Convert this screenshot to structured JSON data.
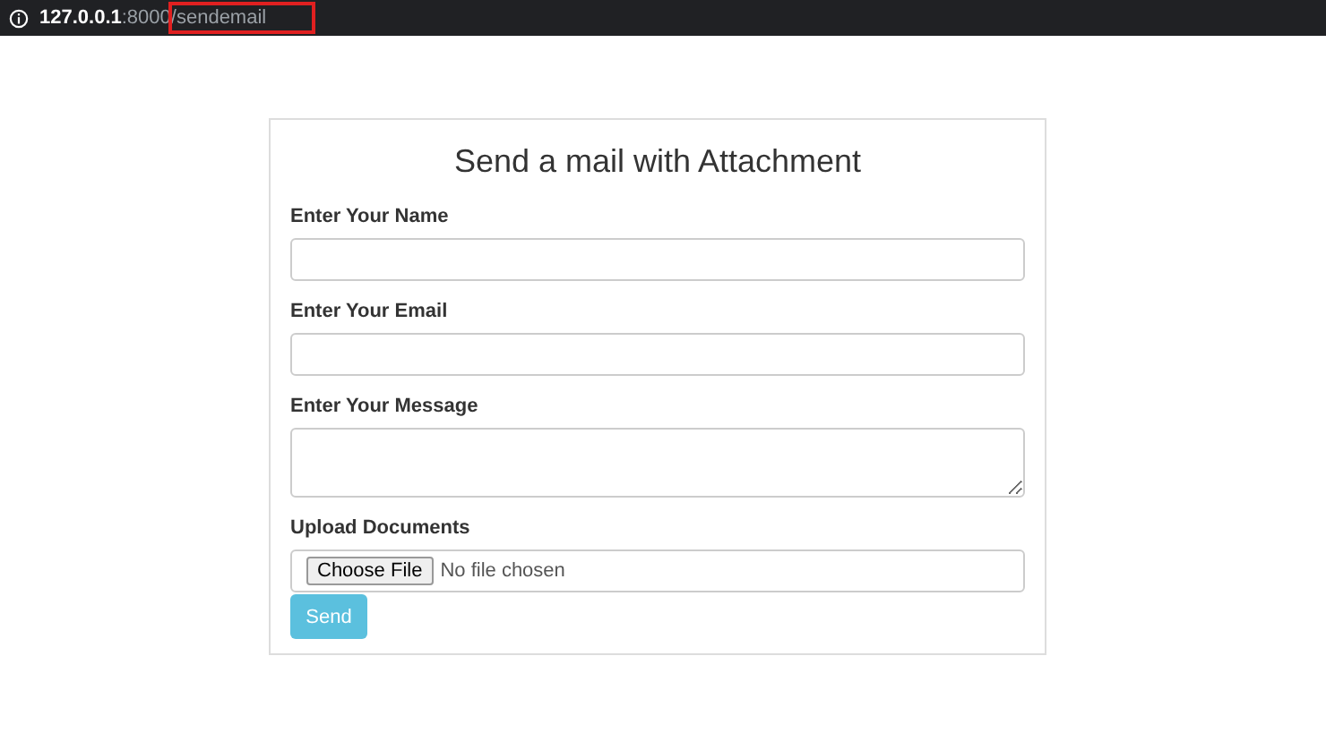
{
  "address_bar": {
    "host": "127.0.0.1",
    "port": ":8000",
    "path": "/sendemail",
    "path_highlighted": true
  },
  "form": {
    "title": "Send a mail with Attachment",
    "fields": [
      {
        "kind": "text",
        "label": "Enter Your Name"
      },
      {
        "kind": "text",
        "label": "Enter Your Email"
      },
      {
        "kind": "textarea",
        "label": "Enter Your Message"
      },
      {
        "kind": "file",
        "label": "Upload Documents",
        "button": "Choose File",
        "status": "No file chosen"
      }
    ],
    "submit": "Send"
  }
}
